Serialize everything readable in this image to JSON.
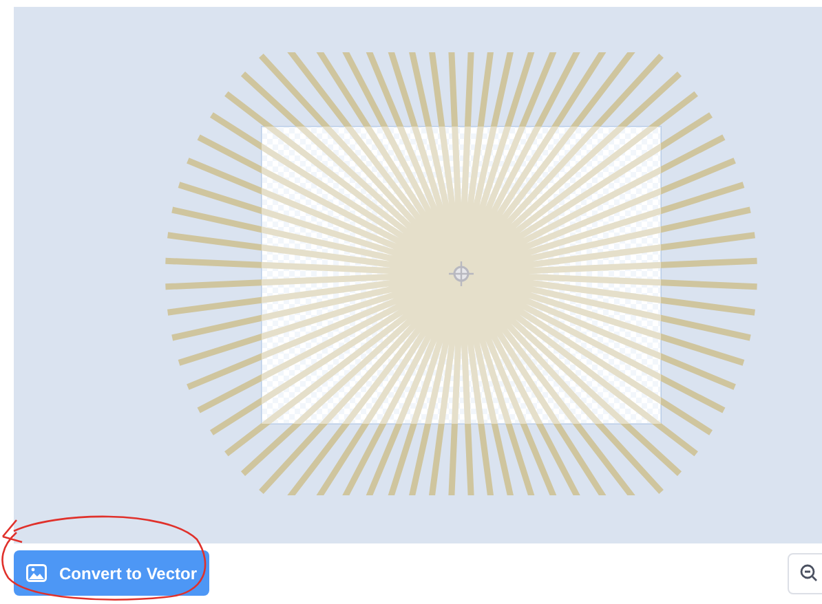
{
  "toolbar": {
    "convert_button": {
      "label": "Convert to Vector"
    }
  }
}
